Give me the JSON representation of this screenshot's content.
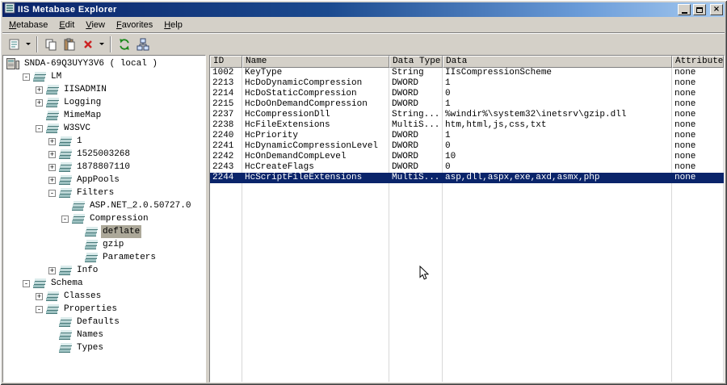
{
  "window": {
    "title": "IIS Metabase Explorer",
    "controls": [
      {
        "name": "minimize",
        "icon": "minimize-icon"
      },
      {
        "name": "maximize",
        "icon": "maximize-icon"
      },
      {
        "name": "close",
        "icon": "close-icon"
      }
    ]
  },
  "menu": {
    "items": [
      {
        "label": "Metabase"
      },
      {
        "label": "Edit"
      },
      {
        "label": "View"
      },
      {
        "label": "Favorites"
      },
      {
        "label": "Help"
      }
    ]
  },
  "toolbar": {
    "buttons": [
      {
        "name": "new-record",
        "icon": "new-record-icon"
      },
      {
        "name": "copy",
        "icon": "copy-icon"
      },
      {
        "name": "paste",
        "icon": "paste-icon"
      },
      {
        "name": "delete",
        "icon": "delete-icon"
      },
      {
        "name": "refresh",
        "icon": "refresh-icon"
      },
      {
        "name": "connect",
        "icon": "connect-icon"
      }
    ]
  },
  "tree": {
    "items": [
      {
        "label": "SNDA-69Q3UYY3V6 ( local )",
        "level": 0,
        "expander": "",
        "icon": "computer-icon"
      },
      {
        "label": "LM",
        "level": 1,
        "expander": "-"
      },
      {
        "label": "IISADMIN",
        "level": 2,
        "expander": "+"
      },
      {
        "label": "Logging",
        "level": 2,
        "expander": "+"
      },
      {
        "label": "MimeMap",
        "level": 2,
        "expander": ""
      },
      {
        "label": "W3SVC",
        "level": 2,
        "expander": "-"
      },
      {
        "label": "1",
        "level": 3,
        "expander": "+"
      },
      {
        "label": "1525003268",
        "level": 3,
        "expander": "+"
      },
      {
        "label": "1878807110",
        "level": 3,
        "expander": "+"
      },
      {
        "label": "AppPools",
        "level": 3,
        "expander": "+"
      },
      {
        "label": "Filters",
        "level": 3,
        "expander": "-"
      },
      {
        "label": "ASP.NET_2.0.50727.0",
        "level": 4,
        "expander": ""
      },
      {
        "label": "Compression",
        "level": 4,
        "expander": "-"
      },
      {
        "label": "deflate",
        "level": 5,
        "expander": "",
        "selected": true
      },
      {
        "label": "gzip",
        "level": 5,
        "expander": ""
      },
      {
        "label": "Parameters",
        "level": 5,
        "expander": ""
      },
      {
        "label": "Info",
        "level": 3,
        "expander": "+"
      },
      {
        "label": "Schema",
        "level": 1,
        "expander": "-"
      },
      {
        "label": "Classes",
        "level": 2,
        "expander": "+"
      },
      {
        "label": "Properties",
        "level": 2,
        "expander": "-"
      },
      {
        "label": "Defaults",
        "level": 3,
        "expander": ""
      },
      {
        "label": "Names",
        "level": 3,
        "expander": ""
      },
      {
        "label": "Types",
        "level": 3,
        "expander": ""
      }
    ]
  },
  "table": {
    "columns": [
      "ID",
      "Name",
      "Data Type",
      "Data",
      "Attributes"
    ],
    "rows": [
      [
        "1002",
        "KeyType",
        "String",
        "IIsCompressionScheme",
        "none"
      ],
      [
        "2213",
        "HcDoDynamicCompression",
        "DWORD",
        "1",
        "none"
      ],
      [
        "2214",
        "HcDoStaticCompression",
        "DWORD",
        "0",
        "none"
      ],
      [
        "2215",
        "HcDoOnDemandCompression",
        "DWORD",
        "1",
        "none"
      ],
      [
        "2237",
        "HcCompressionDll",
        "String...",
        "%windir%\\system32\\inetsrv\\gzip.dll",
        "none"
      ],
      [
        "2238",
        "HcFileExtensions",
        "MultiS...",
        "htm,html,js,css,txt",
        "none"
      ],
      [
        "2240",
        "HcPriority",
        "DWORD",
        "1",
        "none"
      ],
      [
        "2241",
        "HcDynamicCompressionLevel",
        "DWORD",
        "0",
        "none"
      ],
      [
        "2242",
        "HcOnDemandCompLevel",
        "DWORD",
        "10",
        "none"
      ],
      [
        "2243",
        "HcCreateFlags",
        "DWORD",
        "0",
        "none"
      ],
      [
        "2244",
        "HcScriptFileExtensions",
        "MultiS...",
        "asp,dll,aspx,exe,axd,asmx,php",
        "none"
      ]
    ],
    "selected_row_index": 10,
    "selected_row_id": "2244"
  },
  "colors": {
    "chrome": "#d4d0c8",
    "titlebar_start": "#0a246a",
    "titlebar_end": "#a6caf0",
    "selection_bg": "#0a246a",
    "selection_text": "#ffffff",
    "inactive_selection_bg": "#aca899",
    "grid_line": "#d8d8d8"
  }
}
